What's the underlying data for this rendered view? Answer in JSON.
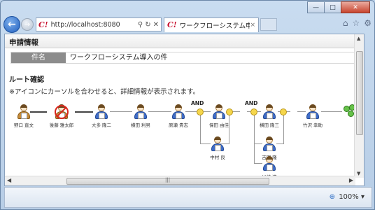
{
  "browser": {
    "url": "http://localhost:8080",
    "tab_title": "ワークフローシステム申...",
    "tab_close": "×",
    "logo": "C!",
    "zoom_label": "100%"
  },
  "page": {
    "header": "申請情報",
    "subject_label": "件名",
    "subject_value": "ワークフローシステム導入の件",
    "route_title": "ルート確認",
    "route_note": "※アイコンにカーソルを合わせると、詳細情報が表示されます。",
    "and_label": "AND",
    "approvers": [
      {
        "name": "野口 直文",
        "status": "done"
      },
      {
        "name": "後藤 雅太郎",
        "status": "denied"
      },
      {
        "name": "大多 隆二",
        "status": "pending"
      },
      {
        "name": "横田 利男",
        "status": "pending"
      },
      {
        "name": "原瀬 貴志",
        "status": "pending"
      },
      {
        "name": "保田 由佳",
        "status": "pending"
      },
      {
        "name": "中村 良",
        "status": "pending"
      },
      {
        "name": "横田 隆三",
        "status": "pending"
      },
      {
        "name": "吉田 隆",
        "status": "pending"
      },
      {
        "name": "川崎 進",
        "status": "pending"
      },
      {
        "name": "竹沢 幸助",
        "status": "pending"
      }
    ]
  },
  "colors": {
    "accent": "#3f6dc9",
    "done": "#c58b3a",
    "denied": "#d9261c",
    "and_node": "#f5d64b"
  },
  "icons": {
    "back": "back-arrow-icon",
    "forward": "forward-arrow-icon",
    "search": "search-icon",
    "refresh": "refresh-icon",
    "stop": "stop-icon",
    "home": "home-icon",
    "favorites": "star-icon",
    "settings": "gear-icon",
    "zoom": "zoom-icon",
    "group": "group-icon"
  }
}
